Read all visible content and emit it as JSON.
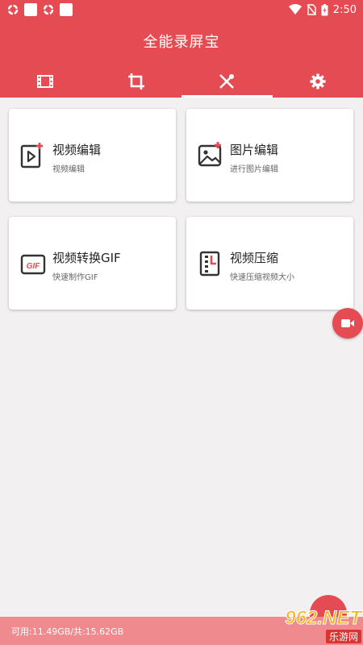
{
  "status_bar": {
    "time": "2:50",
    "icons": [
      "sync-icon",
      "square-icon",
      "sync-icon",
      "square-icon",
      "wifi-icon",
      "no-sim-icon",
      "battery-charging-icon"
    ]
  },
  "app": {
    "title": "全能录屏宝"
  },
  "tabs": [
    {
      "icon": "film-icon",
      "active": false
    },
    {
      "icon": "crop-icon",
      "active": false
    },
    {
      "icon": "tools-icon",
      "active": true
    },
    {
      "icon": "gear-icon",
      "active": false
    }
  ],
  "cards": [
    {
      "title": "视频编辑",
      "subtitle": "视频编辑",
      "icon": "video-edit-icon"
    },
    {
      "title": "图片编辑",
      "subtitle": "进行图片编辑",
      "icon": "image-edit-icon"
    },
    {
      "title": "视频转换GIF",
      "subtitle": "快速制作GIF",
      "icon": "gif-icon",
      "icon_text": "GIF"
    },
    {
      "title": "视频压缩",
      "subtitle": "快速压缩视频大小",
      "icon": "compress-icon"
    }
  ],
  "storage": {
    "text": "可用:11.49GB/共:15.62GB"
  },
  "watermark": {
    "top": "962.NET",
    "bottom": "乐游网"
  },
  "colors": {
    "primary": "#e44b52",
    "footer": "#ef8a8f",
    "background": "#f2f0f1"
  }
}
